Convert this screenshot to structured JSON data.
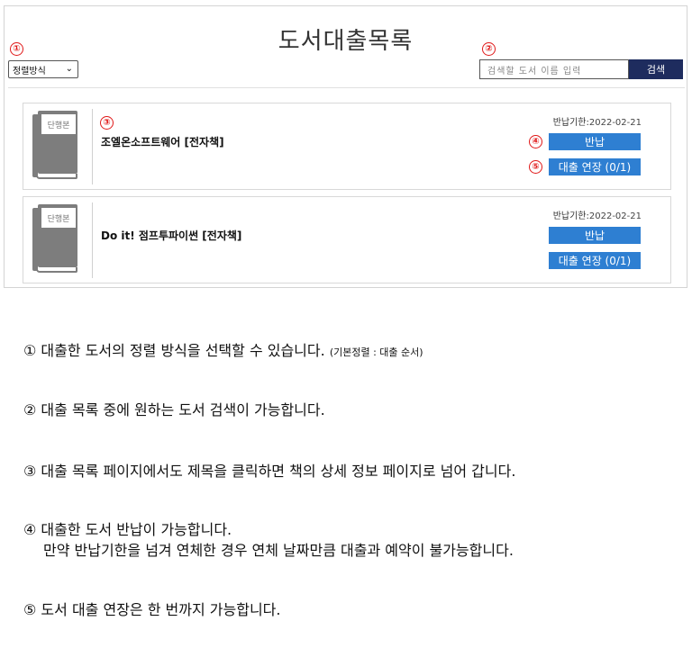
{
  "page_title": "도서대출목록",
  "markers": [
    "①",
    "②",
    "③",
    "④",
    "⑤"
  ],
  "sort": {
    "label": "정렬방식",
    "chevron": "⌄"
  },
  "search": {
    "placeholder": "검색할 도서 이름 입력",
    "button_label": "검색"
  },
  "loans": [
    {
      "cover_label": "단행본",
      "title": "조엘온소프트웨어 [전자책]",
      "due_label": "반납기한:",
      "due_date": "2022-02-21",
      "return_label": "반납",
      "extend_label": "대출 연장 (0/1)"
    },
    {
      "cover_label": "단행본",
      "title": "Do it! 점프투파이썬 [전자책]",
      "due_label": "반납기한:",
      "due_date": "2022-02-21",
      "return_label": "반납",
      "extend_label": "대출 연장 (0/1)"
    }
  ],
  "explanations": {
    "e1_main": "① 대출한 도서의 정렬 방식을 선택할 수 있습니다.",
    "e1_note": "(기본정렬 : 대출 순서)",
    "e2": "② 대출 목록 중에 원하는 도서 검색이 가능합니다.",
    "e3": "③ 대출 목록 페이지에서도 제목을 클릭하면 책의 상세 정보 페이지로 넘어 갑니다.",
    "e4_line1": "④ 대출한 도서 반납이 가능합니다.",
    "e4_line2": "만약 반납기한을 넘겨 연체한 경우 연체 날짜만큼 대출과 예약이 불가능합니다.",
    "e5": "⑤ 도서 대출 연장은 한 번까지 가능합니다."
  }
}
